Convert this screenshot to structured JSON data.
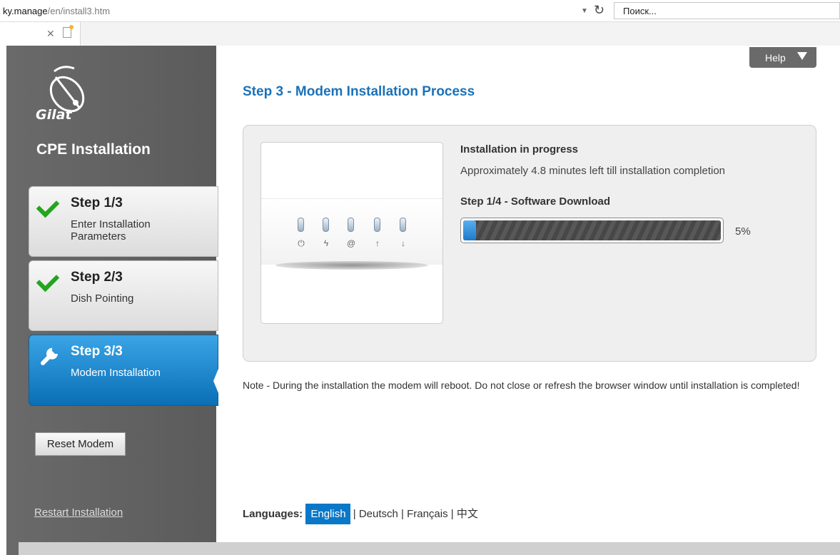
{
  "browser": {
    "url_host": "ky.manage",
    "url_path": "/en/install3.htm",
    "search_placeholder": "Поиск..."
  },
  "sidebar": {
    "logo_text": "Gilat",
    "title": "CPE Installation",
    "steps": [
      {
        "title": "Step 1/3",
        "desc": "Enter Installation Parameters",
        "state": "done"
      },
      {
        "title": "Step 2/3",
        "desc": "Dish Pointing",
        "state": "done"
      },
      {
        "title": "Step 3/3",
        "desc": "Modem Installation",
        "state": "active"
      }
    ],
    "reset_label": "Reset Modem",
    "restart_label": "Restart Installation"
  },
  "help_label": "Help",
  "main": {
    "title": "Step 3 - Modem Installation Process",
    "status_title": "Installation in progress",
    "status_eta": "Approximately 4.8 minutes left till installation completion",
    "step_title": "Step 1/4 - Software Download",
    "progress_pct": "5%",
    "progress_value": 0.05,
    "note": "Note - During the installation the modem will reboot. Do not close or refresh the browser window until installation is completed!",
    "led_icons": [
      "⏻",
      "ϟ",
      "@",
      "↑",
      "↓"
    ]
  },
  "languages": {
    "label": "Languages:",
    "items": [
      "English",
      "Deutsch",
      "Français",
      "中文"
    ],
    "active": "English"
  },
  "colors": {
    "accent": "#1a72b8",
    "active_step": "#0a6fb5",
    "check": "#23a51d",
    "sidebar": "#5f5f5f"
  }
}
